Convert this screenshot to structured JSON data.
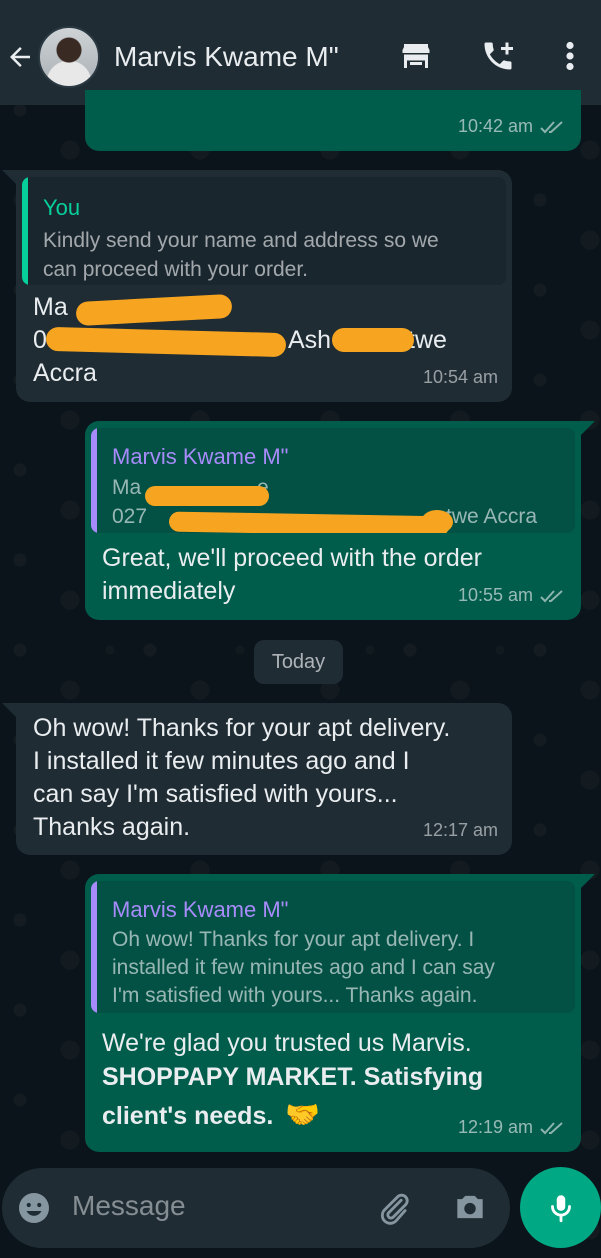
{
  "header": {
    "contact_name": "Marvis Kwame M\"",
    "icons": [
      "back-arrow-icon",
      "store-icon",
      "add-call-icon",
      "more-vert-icon"
    ]
  },
  "messages": {
    "m1": {
      "time": "10:42 am"
    },
    "m2": {
      "quote_author": "You",
      "quote_text_1": "Kindly send your name and address so we",
      "quote_text_2": "can proceed with your order.",
      "line1": "Ma",
      "line2a": "0",
      "line2b": "Ash",
      "line2c": "twe",
      "line3": "Accra",
      "time": "10:54 am"
    },
    "m3": {
      "quote_author": "Marvis Kwame M\"",
      "quote_line1a": "Ma",
      "quote_line1b": "e",
      "quote_line2a": "027",
      "quote_line2b": "twe Accra",
      "text_1": "Great, we'll proceed with the order",
      "text_2": "immediately",
      "time": "10:55 am"
    },
    "date_chip": "Today",
    "m4": {
      "text_1": "Oh wow! Thanks for your apt delivery.",
      "text_2": "I installed it few minutes ago and I",
      "text_3": "can say I'm satisfied with yours...",
      "text_4": "Thanks again.",
      "time": "12:17 am"
    },
    "m5": {
      "quote_author": "Marvis Kwame M\"",
      "quote_text_1": "Oh wow! Thanks for your apt delivery. I",
      "quote_text_2": "installed it few minutes ago and I can say",
      "quote_text_3": "I'm satisfied with yours... Thanks again.",
      "text_1": "We're glad you trusted us Marvis.",
      "text_bold_1": "SHOPPAPY MARKET. Satisfying",
      "text_bold_2": "client's needs.",
      "emoji": "🤝",
      "time": "12:19 am"
    }
  },
  "composer": {
    "placeholder": "Message",
    "icons": [
      "emoji-icon",
      "attach-icon",
      "camera-icon",
      "mic-icon"
    ]
  },
  "colors": {
    "header_bg": "#1f2c34",
    "outgoing_bubble": "#005c4b",
    "incoming_bubble": "#1f2c34",
    "accent_green": "#00a884",
    "quote_you_name": "#06cf9c",
    "quote_contact_name": "#a78bfa",
    "redaction": "#f7a520"
  }
}
